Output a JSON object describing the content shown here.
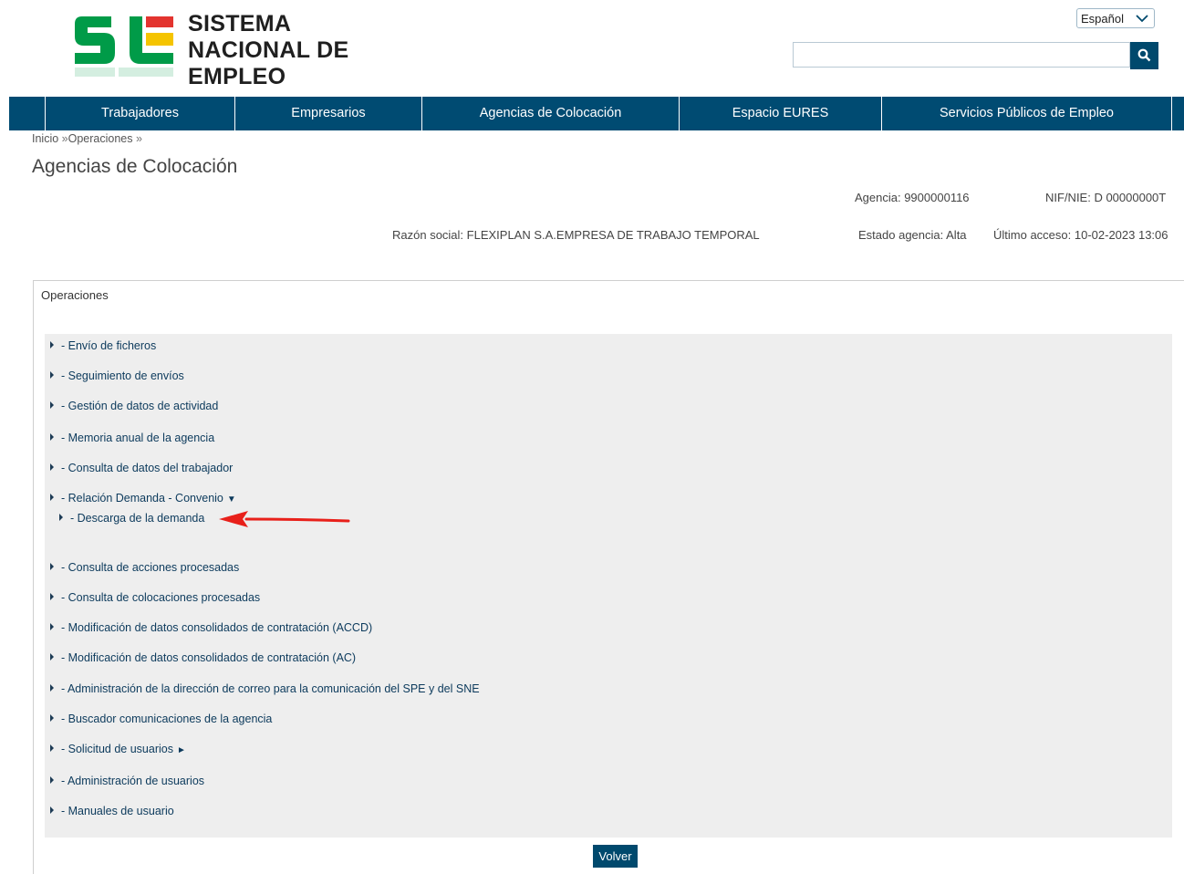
{
  "brand": {
    "line1": "SISTEMA",
    "line2": "NACIONAL DE EMPLEO",
    "colors": {
      "green": "#009b48",
      "yellow": "#f5c400",
      "red": "#e3342f",
      "navy": "#004b72"
    }
  },
  "language": {
    "selected": "Español"
  },
  "search": {
    "value": "",
    "placeholder": ""
  },
  "nav": {
    "items": [
      {
        "label": "Trabajadores"
      },
      {
        "label": "Empresarios"
      },
      {
        "label": "Agencias de Colocación"
      },
      {
        "label": "Espacio EURES"
      },
      {
        "label": "Servicios Públicos de Empleo"
      }
    ]
  },
  "breadcrumb": {
    "home": "Inicio",
    "sep1": " »",
    "current": "Operaciones",
    "sep2": " »"
  },
  "page": {
    "title": "Agencias de Colocación"
  },
  "agency": {
    "agencia": "Agencia: 9900000116",
    "nif": "NIF/NIE: D 00000000T",
    "razon_social": "Razón social: FLEXIPLAN S.A.EMPRESA DE TRABAJO TEMPORAL",
    "estado": "Estado agencia: Alta",
    "ultimo_acceso": "Último acceso: 10-02-2023 13:06"
  },
  "operations": {
    "title": "Operaciones",
    "items": [
      {
        "label": "- Envío de ficheros"
      },
      {
        "label": "- Seguimiento de envíos"
      },
      {
        "label": "- Gestión de datos de actividad"
      },
      {
        "label": "- Memoria anual de la agencia"
      },
      {
        "label": "- Consulta de datos del trabajador"
      },
      {
        "label": "- Relación Demanda - Convenio",
        "suffix": "▼"
      },
      {
        "label": "- Descarga de la demanda"
      },
      {
        "label": "- Consulta de acciones procesadas"
      },
      {
        "label": "- Consulta de colocaciones procesadas"
      },
      {
        "label": "- Modificación de datos consolidados de contratación (ACCD)"
      },
      {
        "label": "- Modificación de datos consolidados de contratación (AC)"
      },
      {
        "label": "- Administración de la dirección de correo para la comunicación del SPE y del SNE"
      },
      {
        "label": "- Buscador comunicaciones de la agencia"
      },
      {
        "label": "- Solicitud de usuarios",
        "suffix": "►"
      },
      {
        "label": "- Administración de usuarios"
      },
      {
        "label": "- Manuales de usuario"
      }
    ]
  },
  "footer": {
    "volver": "Volver"
  }
}
